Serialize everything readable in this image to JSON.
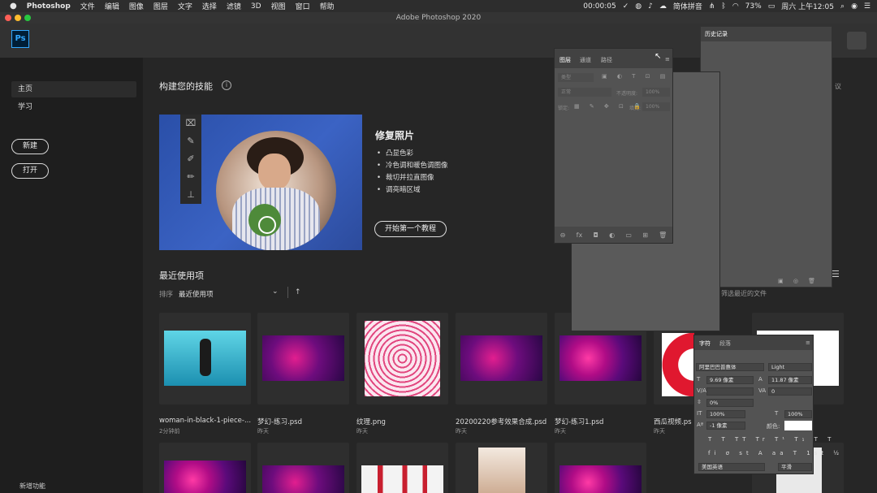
{
  "menubar": {
    "app": "Photoshop",
    "items": [
      "文件",
      "编辑",
      "图像",
      "图层",
      "文字",
      "选择",
      "滤镜",
      "3D",
      "视图",
      "窗口",
      "帮助"
    ],
    "timer": "00:00:05",
    "input_method": "简体拼音",
    "battery": "73%",
    "clock": "周六 上午12:05"
  },
  "window": {
    "title": "Adobe Photoshop 2020"
  },
  "logo": "Ps",
  "sidebar": {
    "items": [
      {
        "label": "主页"
      },
      {
        "label": "学习"
      }
    ],
    "new_button": "新建",
    "open_button": "打开",
    "new_features": "新增功能"
  },
  "skills": {
    "heading": "构建您的技能",
    "info_icon": "i",
    "card_title": "修复照片",
    "bullets": [
      "凸显色彩",
      "冷色调和暖色调图像",
      "裁切并拉直图像",
      "调亮暗区域"
    ],
    "tutorial_button": "开始第一个教程"
  },
  "recent": {
    "heading": "最近使用项",
    "sort_label": "排序",
    "sort_value": "最近使用项",
    "sort_arrow": "↑",
    "files": [
      {
        "name": "woman-in-black-1-piece-...",
        "time": "2分钟前"
      },
      {
        "name": "梦幻-练习.psd",
        "time": "昨天"
      },
      {
        "name": "纹理.png",
        "time": "昨天"
      },
      {
        "name": "20200220参考效果合成.psd",
        "time": "昨天"
      },
      {
        "name": "梦幻-练习1.psd",
        "time": "昨天"
      },
      {
        "name": "西瓜视频.ps",
        "time": "昨天"
      }
    ],
    "right_partial": "议",
    "right_partial2": "筛选最近的文件"
  },
  "layers_panel": {
    "tabs": [
      "图层",
      "通道",
      "路径"
    ],
    "search_placeholder": "类型",
    "blend_mode": "正常",
    "opacity_label": "不透明度:",
    "opacity_value": "100%",
    "lock_label": "锁定:",
    "fill_label": "填充:",
    "fill_value": "100%",
    "footer_icons": [
      "⊖",
      "fx",
      "◘",
      "◐",
      "▭",
      "⊞",
      "🗑"
    ]
  },
  "history_panel": {
    "tab": "历史记录"
  },
  "character_panel": {
    "tabs": [
      "字符",
      "段落"
    ],
    "font_family": "阿里巴巴普惠体",
    "font_style": "Light",
    "font_size": "9.69 像素",
    "leading": "11.87 像素",
    "tracking": "0",
    "scale_percent": "0%",
    "vertical_scale": "100%",
    "horizontal_scale": "100%",
    "baseline": "-1 像素",
    "color_label": "颜色:",
    "language": "美国英语",
    "antialias": "平滑",
    "style_buttons": "T T TT Tr T¹ T₁ T T",
    "opentype_buttons": "fi σ st A aa T 1st ½"
  }
}
